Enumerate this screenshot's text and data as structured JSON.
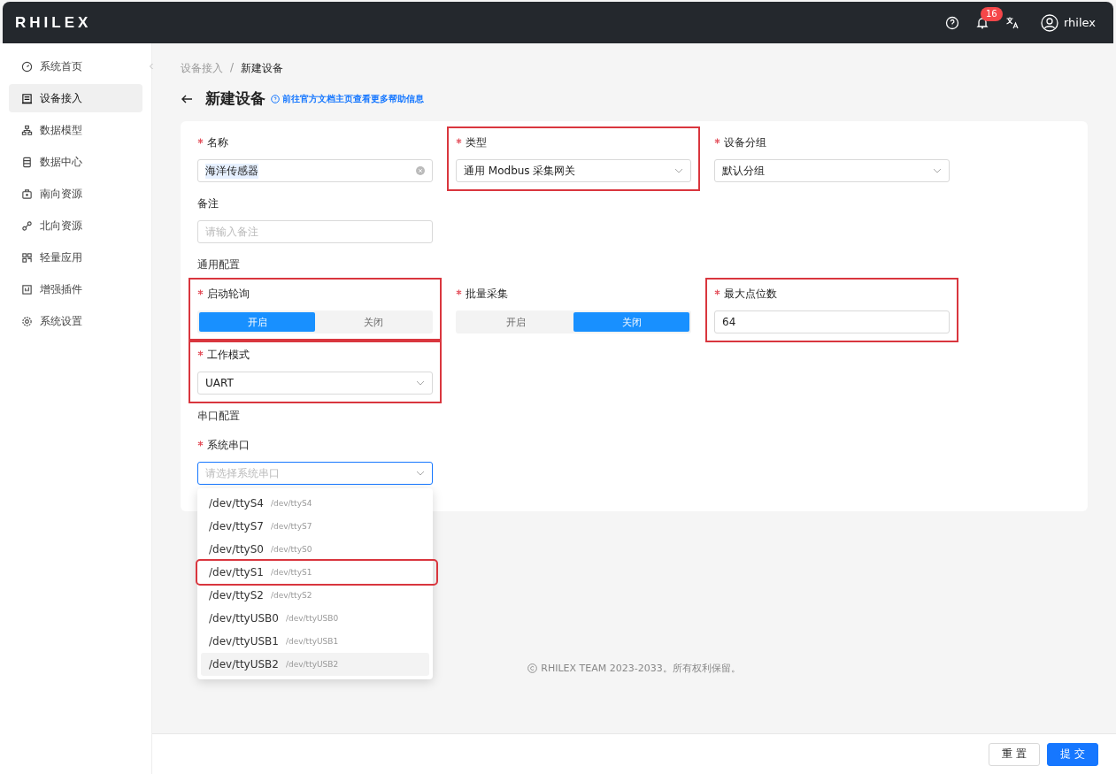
{
  "header": {
    "logo": "RHILEX",
    "notification_count": "16",
    "user": "rhilex"
  },
  "sidebar": {
    "items": [
      {
        "label": "系统首页",
        "selected": false
      },
      {
        "label": "设备接入",
        "selected": true
      },
      {
        "label": "数据模型",
        "selected": false
      },
      {
        "label": "数据中心",
        "selected": false
      },
      {
        "label": "南向资源",
        "selected": false
      },
      {
        "label": "北向资源",
        "selected": false
      },
      {
        "label": "轻量应用",
        "selected": false
      },
      {
        "label": "增强插件",
        "selected": false
      },
      {
        "label": "系统设置",
        "selected": false
      }
    ]
  },
  "breadcrumb": {
    "separator": "/",
    "items": [
      {
        "label": "设备接入"
      },
      {
        "label": "新建设备"
      }
    ]
  },
  "page": {
    "title": "新建设备",
    "help_link": "前往官方文档主页查看更多帮助信息"
  },
  "form": {
    "rows": [
      {
        "kind": "fields",
        "fields": [
          {
            "kind": "input",
            "label": "名称",
            "required": true,
            "highlighted": false,
            "value": "海洋传感器",
            "selected_text": true
          },
          {
            "kind": "select",
            "label": "类型",
            "required": true,
            "highlighted": true,
            "value": "通用 Modbus 采集网关"
          },
          {
            "kind": "select",
            "label": "设备分组",
            "required": true,
            "highlighted": false,
            "value": "默认分组"
          }
        ]
      },
      {
        "kind": "fields",
        "fields": [
          {
            "kind": "input",
            "label": "备注",
            "required": false,
            "highlighted": false,
            "placeholder": "请输入备注"
          }
        ]
      },
      {
        "kind": "section",
        "title": "通用配置"
      },
      {
        "kind": "fields",
        "fields": [
          {
            "kind": "segmented",
            "label": "启动轮询",
            "required": true,
            "highlighted": true,
            "options": [
              {
                "label": "开启",
                "selected": true
              },
              {
                "label": "关闭",
                "selected": false
              }
            ]
          },
          {
            "kind": "segmented",
            "label": "批量采集",
            "required": true,
            "highlighted": false,
            "options": [
              {
                "label": "开启",
                "selected": false
              },
              {
                "label": "关闭",
                "selected": true
              }
            ]
          },
          {
            "kind": "input",
            "label": "最大点位数",
            "required": true,
            "highlighted": true,
            "value": "64"
          }
        ]
      },
      {
        "kind": "fields",
        "fields": [
          {
            "kind": "select",
            "label": "工作模式",
            "required": true,
            "highlighted": true,
            "value": "UART"
          }
        ]
      },
      {
        "kind": "section",
        "title": "串口配置"
      },
      {
        "kind": "fields",
        "fields": [
          {
            "kind": "select",
            "label": "系统串口",
            "required": true,
            "highlighted": false,
            "placeholder": "请选择系统串口",
            "focused": true
          }
        ]
      }
    ]
  },
  "dropdown": {
    "options": [
      {
        "label": "/dev/ttyS4",
        "value": "/dev/ttyS4",
        "hovered": false,
        "highlighted": false
      },
      {
        "label": "/dev/ttyS7",
        "value": "/dev/ttyS7",
        "hovered": false,
        "highlighted": false
      },
      {
        "label": "/dev/ttyS0",
        "value": "/dev/ttyS0",
        "hovered": false,
        "highlighted": false
      },
      {
        "label": "/dev/ttyS1",
        "value": "/dev/ttyS1",
        "hovered": false,
        "highlighted": true
      },
      {
        "label": "/dev/ttyS2",
        "value": "/dev/ttyS2",
        "hovered": false,
        "highlighted": false
      },
      {
        "label": "/dev/ttyUSB0",
        "value": "/dev/ttyUSB0",
        "hovered": false,
        "highlighted": false
      },
      {
        "label": "/dev/ttyUSB1",
        "value": "/dev/ttyUSB1",
        "hovered": false,
        "highlighted": false
      },
      {
        "label": "/dev/ttyUSB2",
        "value": "/dev/ttyUSB2",
        "hovered": true,
        "highlighted": false
      }
    ]
  },
  "footer": {
    "copyright": "RHILEX TEAM 2023-2033。所有权利保留。"
  },
  "actions": [
    {
      "label": "重 置",
      "kind": "default"
    },
    {
      "label": "提 交",
      "kind": "primary"
    }
  ]
}
